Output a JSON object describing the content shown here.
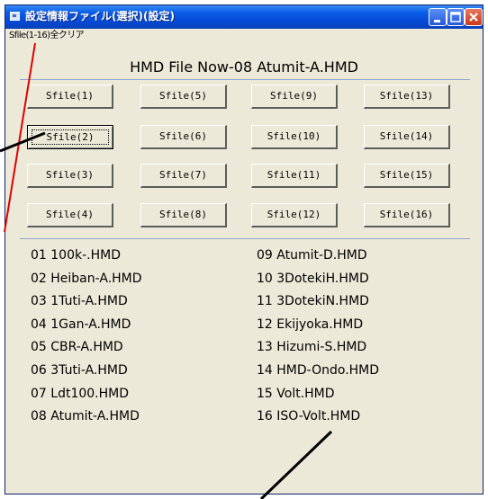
{
  "window": {
    "title": "設定情報ファイル(選択)(設定)"
  },
  "menu": {
    "items": [
      "Sfile(1-16)全クリア"
    ]
  },
  "now_label": "HMD File Now-08 Atumit-A.HMD",
  "sfile_buttons": [
    "Sfile(1)",
    "Sfile(5)",
    "Sfile(9)",
    "Sfile(13)",
    "Sfile(2)",
    "Sfile(6)",
    "Sfile(10)",
    "Sfile(14)",
    "Sfile(3)",
    "Sfile(7)",
    "Sfile(11)",
    "Sfile(15)",
    "Sfile(4)",
    "Sfile(8)",
    "Sfile(12)",
    "Sfile(16)"
  ],
  "files": {
    "left": [
      "01 100k-.HMD",
      "02 Heiban-A.HMD",
      "03 1Tuti-A.HMD",
      "04 1Gan-A.HMD",
      "05 CBR-A.HMD",
      "06 3Tuti-A.HMD",
      "07 Ldt100.HMD",
      "08 Atumit-A.HMD"
    ],
    "right": [
      "09 Atumit-D.HMD",
      "10 3DotekiH.HMD",
      "11 3DotekiN.HMD",
      "12 Ekijyoka.HMD",
      "13 Hizumi-S.HMD",
      "14 HMD-Ondo.HMD",
      "15 Volt.HMD",
      "16 ISO-Volt.HMD"
    ]
  }
}
